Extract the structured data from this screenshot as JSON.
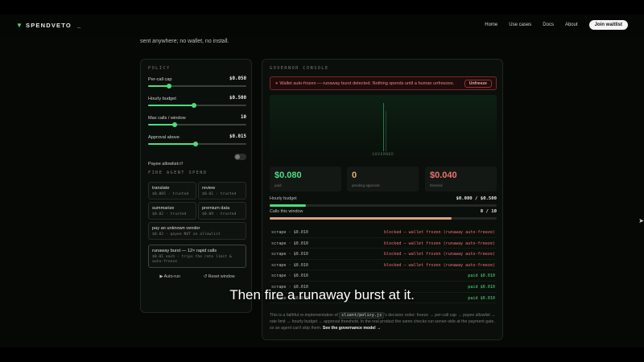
{
  "nav": {
    "brand": "SPENDVETO",
    "cursor": "_",
    "links": [
      "Home",
      "Use cases",
      "Docs",
      "About"
    ],
    "cta": "Join waitlist"
  },
  "intro": "sent anywhere; no wallet, no install.",
  "policy": {
    "title": "POLICY",
    "sliders": [
      {
        "label": "Per-call cap",
        "value": "$0.050",
        "fraction": 0.21
      },
      {
        "label": "Hourly budget",
        "value": "$0.500",
        "fraction": 0.47
      },
      {
        "label": "Max calls / window",
        "value": "10",
        "fraction": 0.27
      },
      {
        "label": "Approval above",
        "value": "$0.015",
        "fraction": 0.48
      }
    ],
    "toggle_label": "Payee allowlist",
    "toggle_state": "off",
    "fire_title": "FIRE AGENT SPEND",
    "agents": [
      {
        "title": "translate",
        "sub": "$0.005 · trusted"
      },
      {
        "title": "review",
        "sub": "$0.01 · trusted"
      },
      {
        "title": "summarize",
        "sub": "$0.02 · trusted"
      },
      {
        "title": "premium data",
        "sub": "$0.09 · trusted"
      },
      {
        "title": "pay an unknown vendor",
        "sub": "$0.02 · payee NOT on allowlist"
      },
      {
        "title": "runaway burst — 12× rapid calls",
        "sub": "$0.01 each · trips the rate limit & auto-freeze"
      }
    ],
    "auto_run": "▶ Auto-run",
    "reset": "↺ Reset window"
  },
  "console": {
    "title": "GOVERNOR CONSOLE",
    "alert": "Wallet auto-frozen — runaway burst detected. Nothing spends until a human unfreezes.",
    "unfreeze": "Unfreeze",
    "viz_label": "GOVERNED",
    "stats": [
      {
        "value": "$0.080",
        "caption": "paid",
        "color": "#4ade80"
      },
      {
        "value": "0",
        "caption": "pending approval",
        "color": "#e0b36a"
      },
      {
        "value": "$0.040",
        "caption": "blocked",
        "color": "#f07070"
      }
    ],
    "hourly": {
      "label": "Hourly budget",
      "value": "$0.080 / $0.500",
      "fraction": 0.16
    },
    "calls": {
      "label": "Calls this window",
      "value": "8 / 10",
      "fraction": 0.8
    },
    "log": [
      {
        "left": "scrape · $0.010",
        "right": "blocked — wallet frozen (runaway auto-freeze)",
        "status": "blocked"
      },
      {
        "left": "scrape · $0.010",
        "right": "blocked — wallet frozen (runaway auto-freeze)",
        "status": "blocked"
      },
      {
        "left": "scrape · $0.010",
        "right": "blocked — wallet frozen (runaway auto-freeze)",
        "status": "blocked"
      },
      {
        "left": "scrape · $0.010",
        "right": "blocked — wallet frozen (runaway auto-freeze)",
        "status": "blocked"
      },
      {
        "left": "scrape · $0.010",
        "right": "paid $0.010",
        "status": "paid"
      },
      {
        "left": "scrape · $0.010",
        "right": "paid $0.010",
        "status": "paid"
      },
      {
        "left": "scrape · $0.010",
        "right": "paid $0.010",
        "status": "paid"
      }
    ],
    "footnote_pre": "This is a faithful re-implementation of",
    "footnote_code": "client/policy.js",
    "footnote_post": "'s decision order: freeze → per-call cap → payee allowlist → rate limit → hourly budget → approval threshold. In the real product the same checks run server-side at the payment gate, so an agent can't skip them.",
    "footnote_link": "See the governance model →"
  },
  "caption": "Then fire a runaway burst at it.",
  "colors": {
    "accent": "#4ade80",
    "blocked": "#f07070",
    "pending": "#e0b36a",
    "hourly_bar": "#4ade80",
    "calls_bar": "#d9a774"
  }
}
